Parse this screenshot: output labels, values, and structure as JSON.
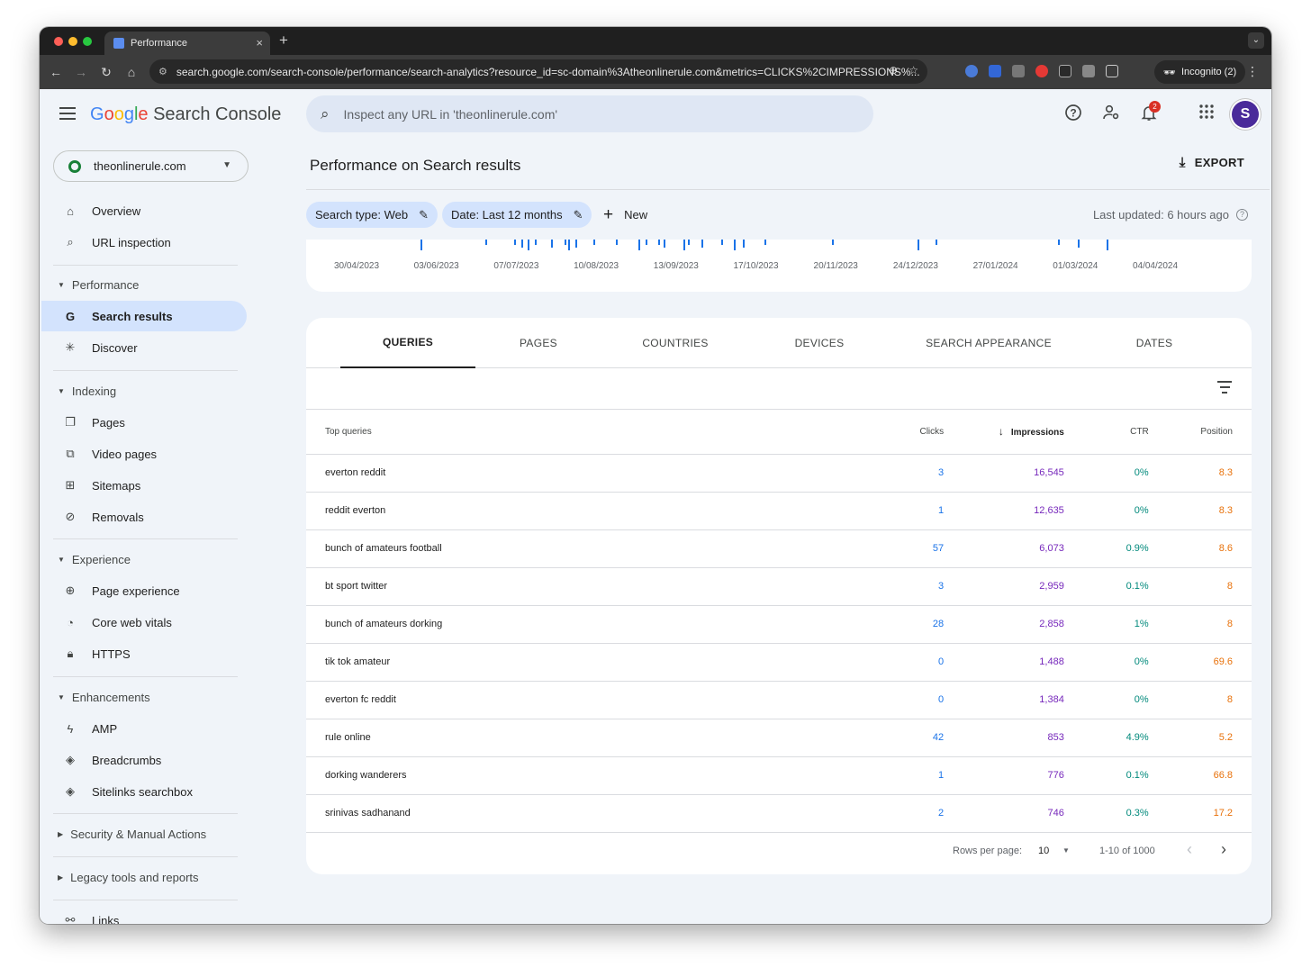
{
  "browser": {
    "tab_title": "Performance",
    "url": "search.google.com/search-console/performance/search-analytics?resource_id=sc-domain%3Atheonlinerule.com&metrics=CLICKS%2CIMPRESSIONS%...",
    "incognito_label": "Incognito (2)"
  },
  "header": {
    "product_name": "Search Console",
    "search_placeholder": "Inspect any URL in 'theonlinerule.com'",
    "notification_count": "2",
    "avatar_letter": "S"
  },
  "sidebar": {
    "property": "theonlinerule.com",
    "items": [
      {
        "label": "Overview",
        "icon": "home-icon"
      },
      {
        "label": "URL inspection",
        "icon": "search-icon"
      }
    ],
    "sections": {
      "performance": {
        "title": "Performance",
        "items": [
          {
            "label": "Search results",
            "icon": "google-g-icon",
            "active": true
          },
          {
            "label": "Discover",
            "icon": "asterisk-icon"
          }
        ]
      },
      "indexing": {
        "title": "Indexing",
        "items": [
          {
            "label": "Pages",
            "icon": "pages-icon"
          },
          {
            "label": "Video pages",
            "icon": "video-pages-icon"
          },
          {
            "label": "Sitemaps",
            "icon": "sitemap-icon"
          },
          {
            "label": "Removals",
            "icon": "eye-off-icon"
          }
        ]
      },
      "experience": {
        "title": "Experience",
        "items": [
          {
            "label": "Page experience",
            "icon": "plus-circle-icon"
          },
          {
            "label": "Core web vitals",
            "icon": "gauge-icon"
          },
          {
            "label": "HTTPS",
            "icon": "lock-icon"
          }
        ]
      },
      "enhancements": {
        "title": "Enhancements",
        "items": [
          {
            "label": "AMP",
            "icon": "bolt-icon"
          },
          {
            "label": "Breadcrumbs",
            "icon": "layers-icon"
          },
          {
            "label": "Sitelinks searchbox",
            "icon": "layers-icon"
          }
        ]
      },
      "security": {
        "title": "Security & Manual Actions"
      },
      "legacy": {
        "title": "Legacy tools and reports"
      }
    },
    "links_label": "Links"
  },
  "main": {
    "title": "Performance on Search results",
    "export_label": "EXPORT",
    "chips": {
      "search_type": "Search type: Web",
      "date": "Date: Last 12 months"
    },
    "new_label": "New",
    "last_updated": "Last updated: 6 hours ago"
  },
  "chart_data": {
    "type": "line",
    "x_ticks": [
      "30/04/2023",
      "03/06/2023",
      "07/07/2023",
      "10/08/2023",
      "13/09/2023",
      "17/10/2023",
      "20/11/2023",
      "24/12/2023",
      "27/01/2024",
      "01/03/2024",
      "04/04/2024"
    ],
    "series_color": "#1a73e8"
  },
  "tabs": [
    "QUERIES",
    "PAGES",
    "COUNTRIES",
    "DEVICES",
    "SEARCH APPEARANCE",
    "DATES"
  ],
  "table": {
    "headers": {
      "query": "Top queries",
      "clicks": "Clicks",
      "impressions": "Impressions",
      "ctr": "CTR",
      "position": "Position"
    },
    "rows": [
      {
        "query": "everton reddit",
        "clicks": "3",
        "impressions": "16,545",
        "ctr": "0%",
        "position": "8.3"
      },
      {
        "query": "reddit everton",
        "clicks": "1",
        "impressions": "12,635",
        "ctr": "0%",
        "position": "8.3"
      },
      {
        "query": "bunch of amateurs football",
        "clicks": "57",
        "impressions": "6,073",
        "ctr": "0.9%",
        "position": "8.6"
      },
      {
        "query": "bt sport twitter",
        "clicks": "3",
        "impressions": "2,959",
        "ctr": "0.1%",
        "position": "8"
      },
      {
        "query": "bunch of amateurs dorking",
        "clicks": "28",
        "impressions": "2,858",
        "ctr": "1%",
        "position": "8"
      },
      {
        "query": "tik tok amateur",
        "clicks": "0",
        "impressions": "1,488",
        "ctr": "0%",
        "position": "69.6"
      },
      {
        "query": "everton fc reddit",
        "clicks": "0",
        "impressions": "1,384",
        "ctr": "0%",
        "position": "8"
      },
      {
        "query": "rule online",
        "clicks": "42",
        "impressions": "853",
        "ctr": "4.9%",
        "position": "5.2"
      },
      {
        "query": "dorking wanderers",
        "clicks": "1",
        "impressions": "776",
        "ctr": "0.1%",
        "position": "66.8"
      },
      {
        "query": "srinivas sadhanand",
        "clicks": "2",
        "impressions": "746",
        "ctr": "0.3%",
        "position": "17.2"
      }
    ]
  },
  "pagination": {
    "rows_per_page_label": "Rows per page:",
    "rows_per_page": "10",
    "range": "1-10 of 1000"
  }
}
